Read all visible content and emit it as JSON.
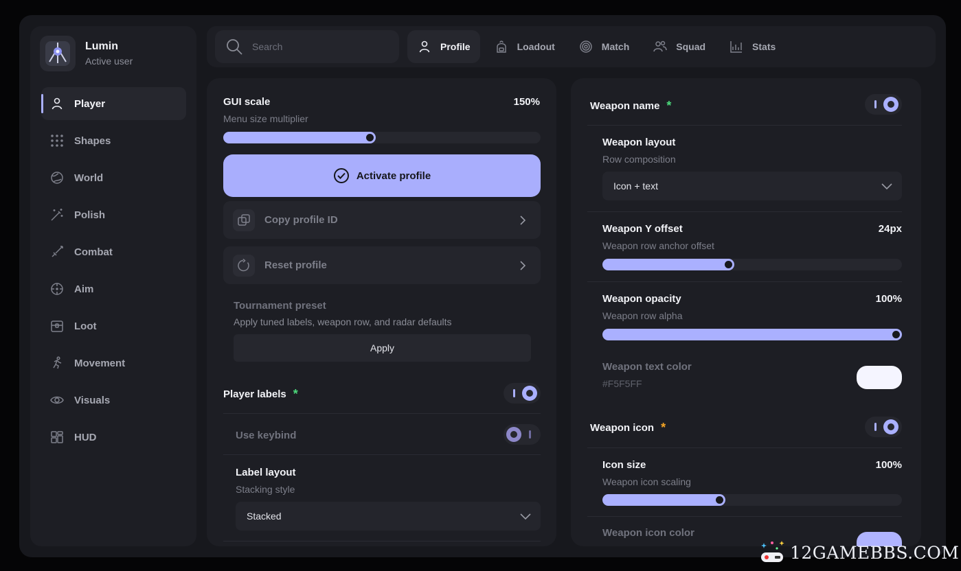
{
  "brand": {
    "name": "Lumin",
    "subtitle": "Active user"
  },
  "sidebar": {
    "items": [
      {
        "label": "Player",
        "icon": "user-icon",
        "active": true
      },
      {
        "label": "Shapes",
        "icon": "grid-dots-icon"
      },
      {
        "label": "World",
        "icon": "globe-icon"
      },
      {
        "label": "Polish",
        "icon": "magic-wand-icon"
      },
      {
        "label": "Combat",
        "icon": "sword-icon"
      },
      {
        "label": "Aim",
        "icon": "crosshair-icon"
      },
      {
        "label": "Loot",
        "icon": "chest-icon"
      },
      {
        "label": "Movement",
        "icon": "running-icon"
      },
      {
        "label": "Visuals",
        "icon": "eye-icon"
      },
      {
        "label": "HUD",
        "icon": "layout-icon"
      }
    ]
  },
  "search": {
    "placeholder": "Search"
  },
  "tabs": [
    {
      "label": "Profile",
      "icon": "user-icon",
      "active": true
    },
    {
      "label": "Loadout",
      "icon": "backpack-icon"
    },
    {
      "label": "Match",
      "icon": "target-icon"
    },
    {
      "label": "Squad",
      "icon": "users-icon"
    },
    {
      "label": "Stats",
      "icon": "chart-icon"
    }
  ],
  "left": {
    "gui_scale": {
      "title": "GUI scale",
      "subtitle": "Menu size multiplier",
      "value": "150%",
      "fraction": 0.48
    },
    "activate_label": "Activate profile",
    "copy_id_label": "Copy profile ID",
    "reset_label": "Reset profile",
    "preset": {
      "title": "Tournament preset",
      "subtitle": "Apply tuned labels, weapon row, and radar defaults",
      "button": "Apply"
    },
    "player_labels": {
      "title": "Player labels",
      "star": "*",
      "enabled": true
    },
    "use_keybind": {
      "label": "Use keybind",
      "enabled": false
    },
    "label_layout": {
      "title": "Label layout",
      "subtitle": "Stacking style",
      "selected": "Stacked"
    }
  },
  "right": {
    "weapon_name": {
      "title": "Weapon name",
      "star": "*",
      "enabled": true
    },
    "weapon_layout": {
      "title": "Weapon layout",
      "subtitle": "Row composition",
      "selected": "Icon + text"
    },
    "weapon_y_offset": {
      "title": "Weapon Y offset",
      "subtitle": "Weapon row anchor offset",
      "value": "24px",
      "fraction": 0.44
    },
    "weapon_opacity": {
      "title": "Weapon opacity",
      "subtitle": "Weapon row alpha",
      "value": "100%",
      "fraction": 1.0
    },
    "weapon_text_color": {
      "title": "Weapon text color",
      "hex": "#F5F5FF"
    },
    "weapon_icon": {
      "title": "Weapon icon",
      "star": "*",
      "enabled": true
    },
    "icon_size": {
      "title": "Icon size",
      "subtitle": "Weapon icon scaling",
      "value": "100%",
      "fraction": 0.41
    },
    "weapon_icon_color": {
      "title": "Weapon icon color",
      "hex": "#B0B4FF"
    }
  },
  "colors": {
    "accent": "#AAB0FF",
    "star_green": "#4CD97B",
    "star_orange": "#F5A524",
    "text_swatch": "#F5F5FF",
    "icon_swatch": "#B0B4FF"
  },
  "watermark": {
    "text": "12GAMEBBS.COM"
  }
}
